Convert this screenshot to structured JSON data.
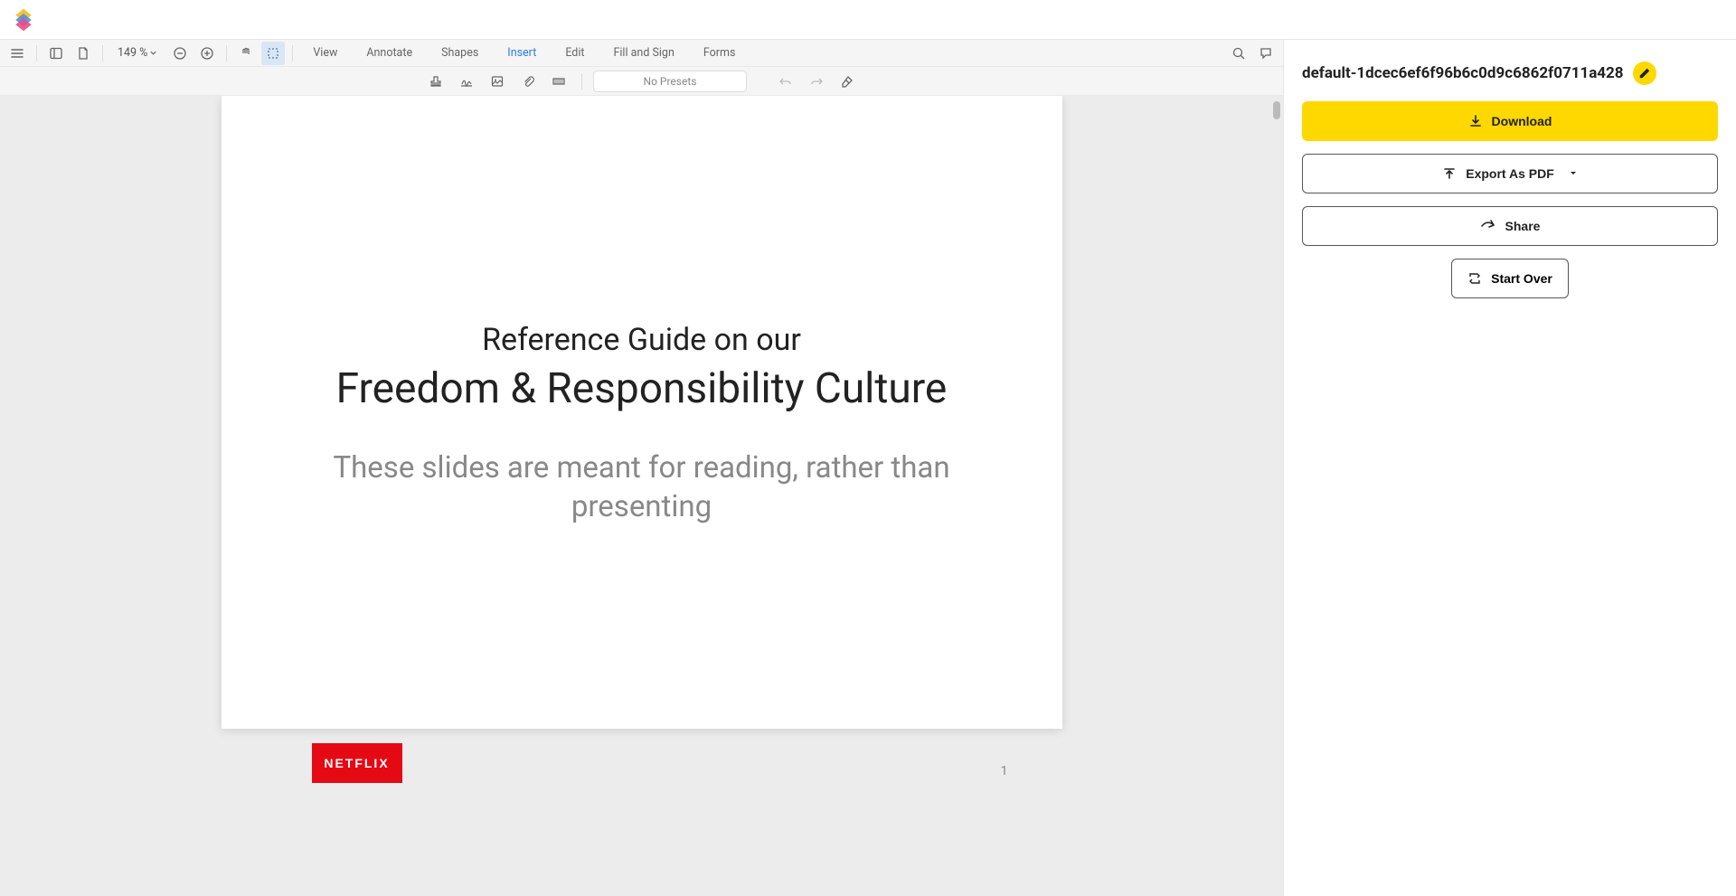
{
  "toolbar": {
    "zoom": "149 %",
    "tabs": [
      "View",
      "Annotate",
      "Shapes",
      "Insert",
      "Edit",
      "Fill and Sign",
      "Forms"
    ],
    "active_tab_index": 3,
    "presets_placeholder": "No Presets"
  },
  "document": {
    "title_line1": "Reference Guide on our",
    "title_line2": "Freedom & Responsibility Culture",
    "subtitle": "These slides are meant for reading, rather than presenting",
    "brand_badge": "NETFLIX",
    "page_number": "1"
  },
  "sidebar": {
    "filename": "default-1dcec6ef6f96b6c0d9c6862f0711a428",
    "download_label": "Download",
    "export_label": "Export As PDF",
    "share_label": "Share",
    "start_over_label": "Start Over"
  }
}
